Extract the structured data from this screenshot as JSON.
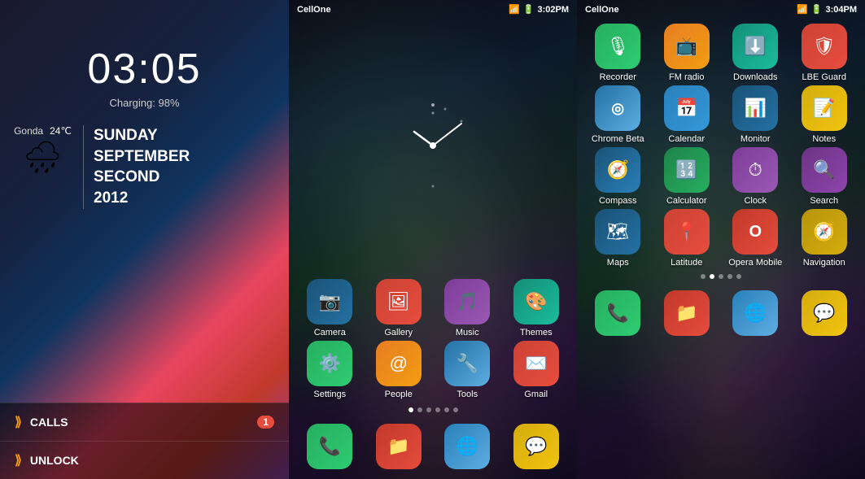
{
  "lock": {
    "time": "03:05",
    "charging": "Charging: 98%",
    "city": "Gonda",
    "temp": "24℃",
    "date_day": "SUNDAY",
    "date_month": "SEPTEMBER",
    "date_word": "SECOND",
    "date_year": "2012",
    "calls_label": "CALLS",
    "calls_count": "1",
    "unlock_label": "UNLOCK"
  },
  "home": {
    "carrier": "CellOne",
    "time": "3:02PM",
    "apps_row1": [
      {
        "label": "Camera",
        "icon": "📷",
        "bg": "bg-camera"
      },
      {
        "label": "Gallery",
        "icon": "🖼",
        "bg": "bg-gallery"
      },
      {
        "label": "Music",
        "icon": "🎵",
        "bg": "bg-music"
      },
      {
        "label": "Themes",
        "icon": "⚙",
        "bg": "bg-themes"
      }
    ],
    "apps_row2": [
      {
        "label": "Settings",
        "icon": "⚙",
        "bg": "bg-settings"
      },
      {
        "label": "People",
        "icon": "@",
        "bg": "bg-people"
      },
      {
        "label": "Tools",
        "icon": "🔧",
        "bg": "bg-tools"
      },
      {
        "label": "Gmail",
        "icon": "✉",
        "bg": "bg-gmail"
      }
    ],
    "dock": [
      {
        "label": "Phone",
        "icon": "📞",
        "bg": "bg-phone"
      },
      {
        "label": "Files",
        "icon": "📁",
        "bg": "bg-files"
      },
      {
        "label": "Browser",
        "icon": "🌐",
        "bg": "bg-globe"
      },
      {
        "label": "Messages",
        "icon": "💬",
        "bg": "bg-msg"
      }
    ]
  },
  "drawer": {
    "carrier": "CellOne",
    "time": "3:04PM",
    "apps_row1": [
      {
        "label": "Recorder",
        "icon": "🎙",
        "bg": "bg-recorder"
      },
      {
        "label": "FM radio",
        "icon": "📻",
        "bg": "bg-fmradio"
      },
      {
        "label": "Downloads",
        "icon": "⬇",
        "bg": "bg-downloads"
      },
      {
        "label": "LBE Guard",
        "icon": "🛡",
        "bg": "bg-lbe"
      }
    ],
    "apps_row2": [
      {
        "label": "Chrome Beta",
        "icon": "◎",
        "bg": "bg-chrome"
      },
      {
        "label": "Calendar",
        "icon": "📅",
        "bg": "bg-calendar"
      },
      {
        "label": "Monitor",
        "icon": "📊",
        "bg": "bg-monitor"
      },
      {
        "label": "Notes",
        "icon": "📝",
        "bg": "bg-notes"
      }
    ],
    "apps_row3": [
      {
        "label": "Compass",
        "icon": "🧭",
        "bg": "bg-compass"
      },
      {
        "label": "Calculator",
        "icon": "🔢",
        "bg": "bg-calc"
      },
      {
        "label": "Clock",
        "icon": "⏱",
        "bg": "bg-clock-purple"
      },
      {
        "label": "Search",
        "icon": "🔍",
        "bg": "bg-search-purple"
      }
    ],
    "apps_row4": [
      {
        "label": "Maps",
        "icon": "🗺",
        "bg": "bg-maps"
      },
      {
        "label": "Latitude",
        "icon": "📍",
        "bg": "bg-latitude"
      },
      {
        "label": "Opera Mobile",
        "icon": "O",
        "bg": "bg-opera"
      },
      {
        "label": "Navigation",
        "icon": "🧭",
        "bg": "bg-nav"
      }
    ],
    "dock": [
      {
        "label": "Phone",
        "icon": "📞",
        "bg": "bg-phone"
      },
      {
        "label": "Files",
        "icon": "📁",
        "bg": "bg-files"
      },
      {
        "label": "Browser",
        "icon": "🌐",
        "bg": "bg-globe"
      },
      {
        "label": "Messages",
        "icon": "💬",
        "bg": "bg-msg"
      }
    ]
  }
}
